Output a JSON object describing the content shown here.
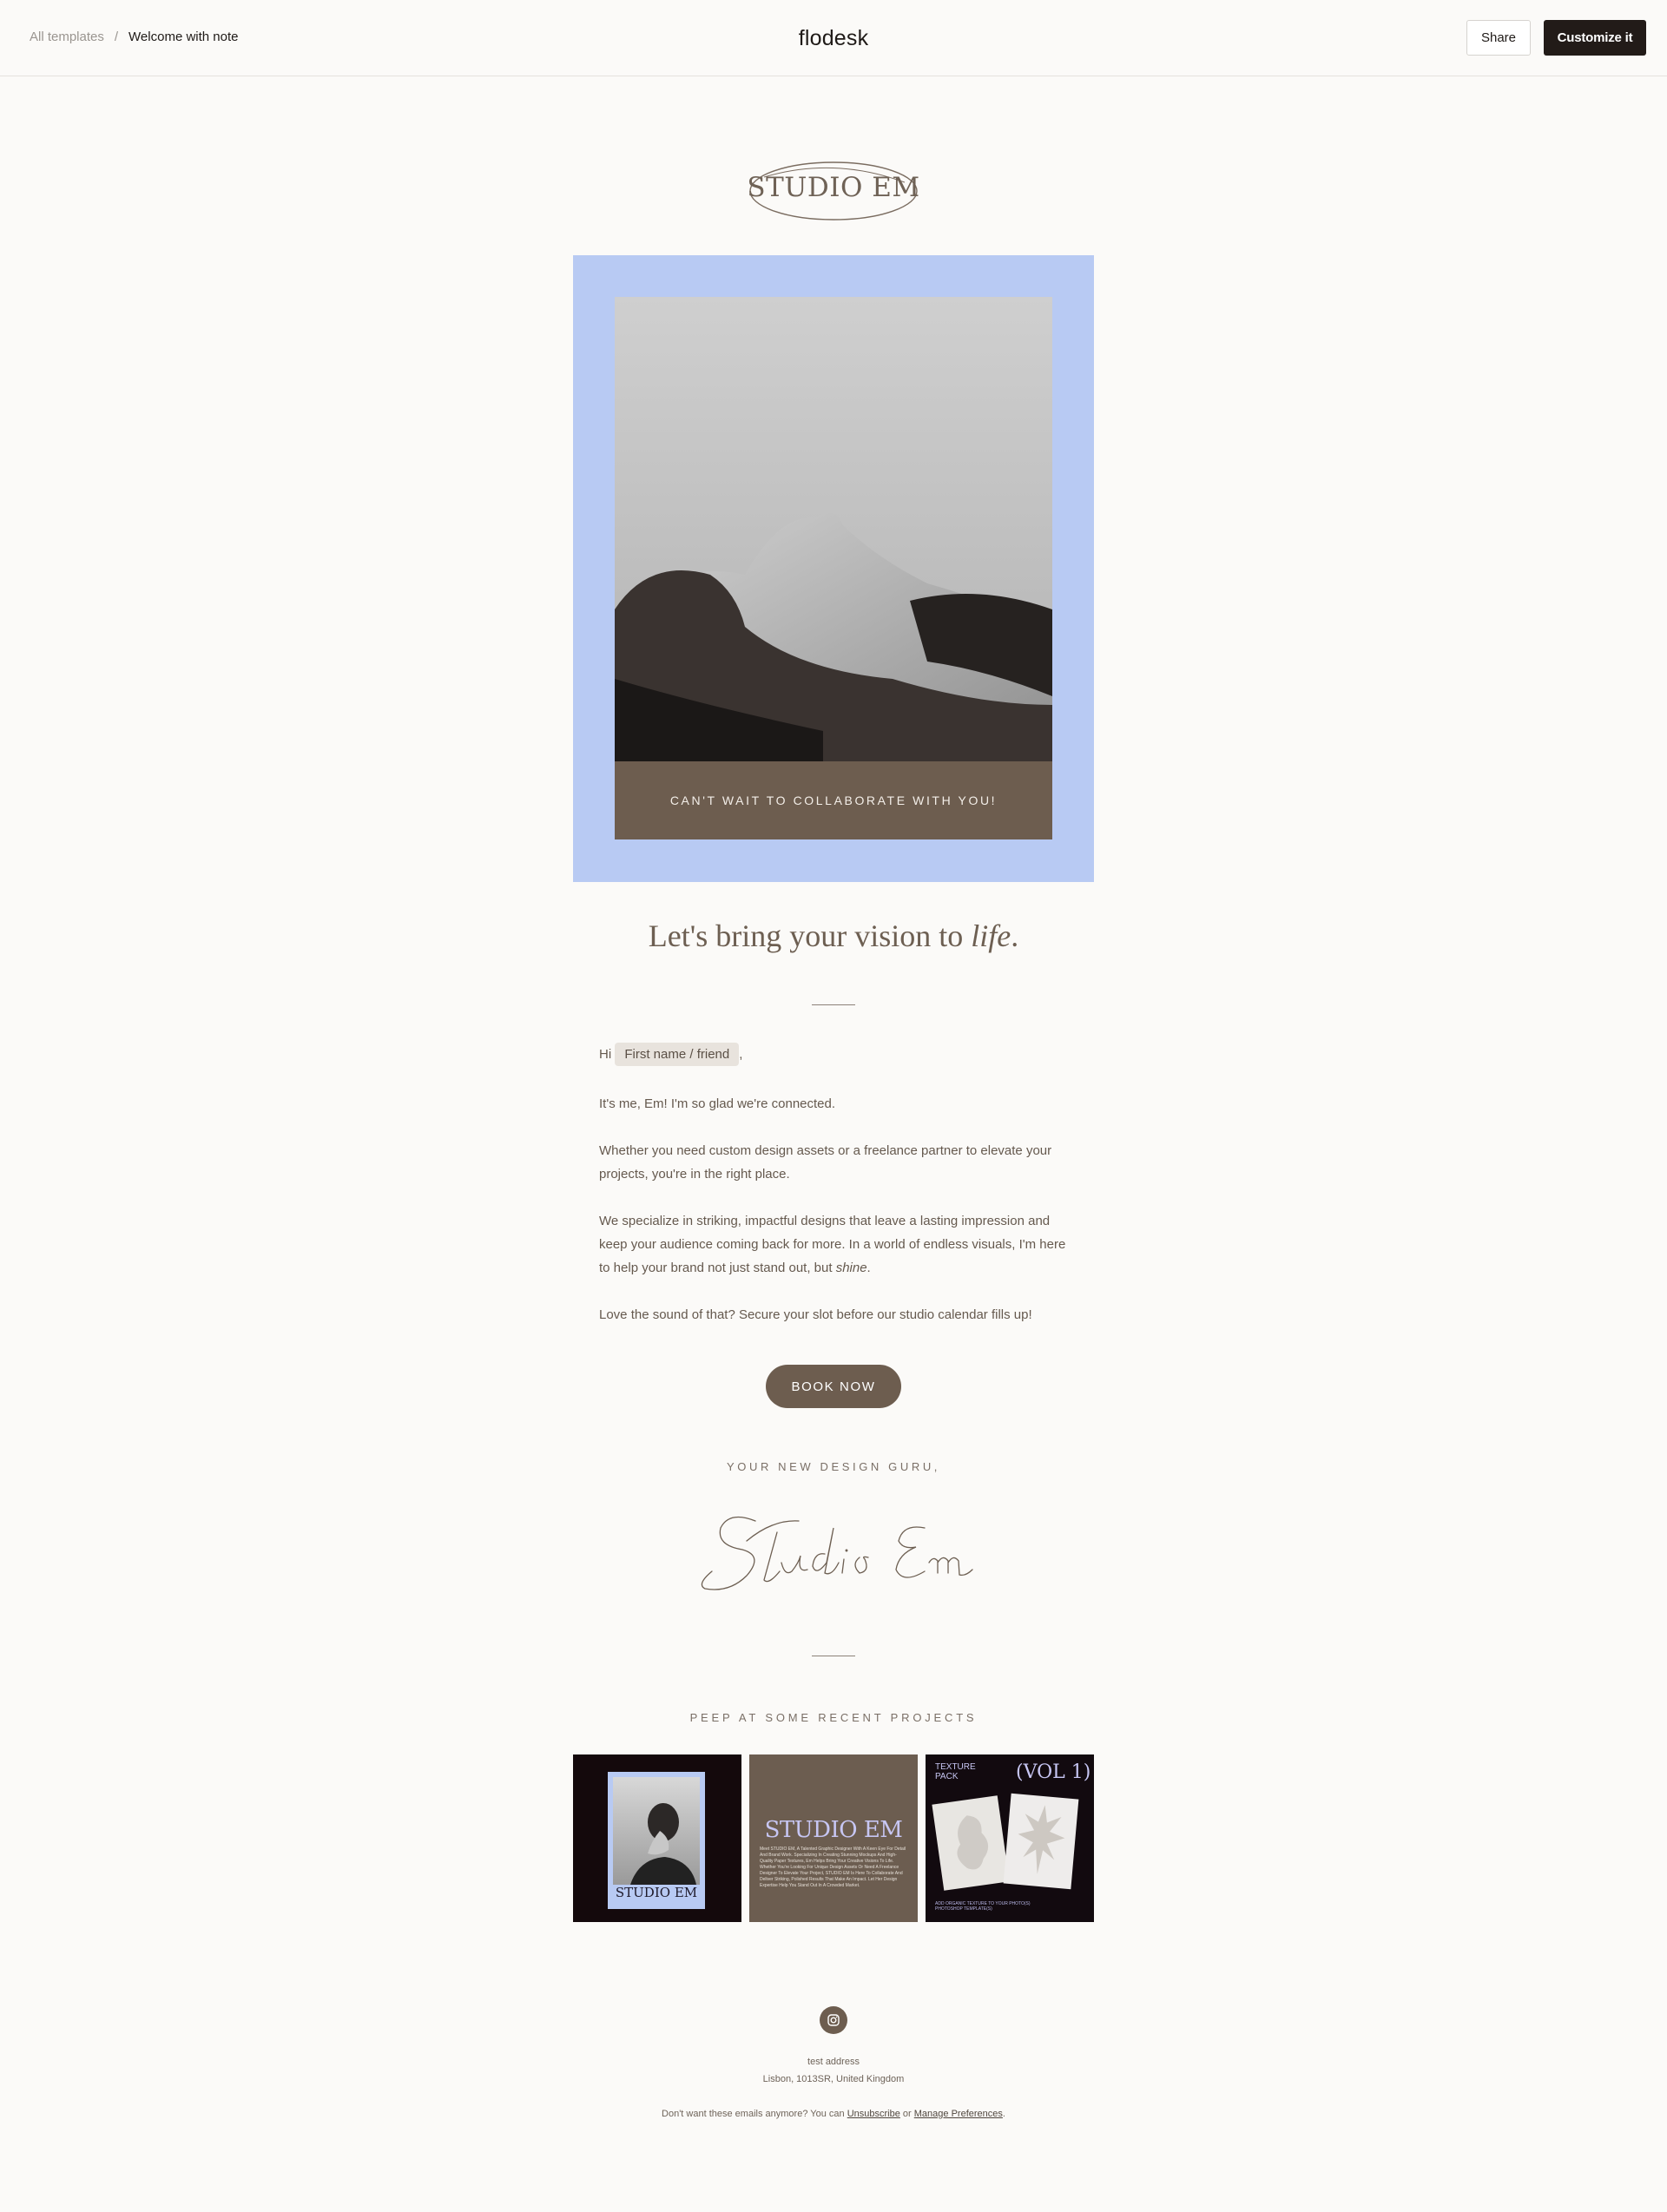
{
  "topbar": {
    "breadcrumb_root": "All templates",
    "breadcrumb_sep": "/",
    "breadcrumb_current": "Welcome with note",
    "brand": "flodesk",
    "share_label": "Share",
    "customize_label": "Customize it"
  },
  "email": {
    "logo_text": "STUDIO EM",
    "hero_caption": "CAN'T WAIT TO COLLABORATE WITH YOU!",
    "headline_main": "Let's bring your vision to ",
    "headline_italic": "life",
    "headline_end": ".",
    "greeting_prefix": "Hi",
    "greeting_tag": "First name / friend",
    "greeting_suffix": ",",
    "para1": "It's me, Em! I'm so glad we're connected.",
    "para2_line1": "Whether you need custom design assets or a freelance partner to elevate your",
    "para2_line2": "projects, you're in the right place.",
    "para3_line1": "We specialize in striking, impactful designs that leave a lasting impression and",
    "para3_line2": "keep your audience coming back for more. In a world of endless visuals, I'm here",
    "para3_line3": "to help your brand not just stand out, but ",
    "para3_italic": "shine",
    "para3_end": ".",
    "para4": "Love the sound of that? Secure your slot before our studio calendar fills up!",
    "cta_label": "BOOK NOW",
    "signoff": "YOUR NEW DESIGN GURU,",
    "signature": "Studio Em",
    "projects_heading": "PEEP AT SOME RECENT PROJECTS",
    "projects": [
      {
        "title": "STUDIO EM"
      },
      {
        "title": "STUDIO EM",
        "body": "Meet STUDIO EM, A Talented Graphic Designer With A Keen Eye For Detail And Brand Work. Specializing In Creating Stunning Mockups And High-Quality Paper Textures, Em Helps Bring Your Creative Visions To Life. Whether You're Looking For Unique Design Assets Or Need A Freelance Designer To Elevate Your Project, STUDIO EM Is Here To Collaborate And Deliver Striking, Polished Results That Make An Impact. Let Her Design Expertise Help You Stand Out In A Crowded Market."
      },
      {
        "label": "TEXTURE PACK",
        "title": "(VOL 1)",
        "caption": "ADD ORGANIC TEXTURE TO YOUR PHOTO(S) PHOTOSHOP TEMPLATE(S)"
      }
    ],
    "footer_address1": "test address",
    "footer_address2": "Lisbon, 1013SR, United Kingdom",
    "footer_unsub_prefix": "Don't want these emails anymore? You can ",
    "footer_unsub_link": "Unsubscribe",
    "footer_or": " or ",
    "footer_prefs_link": "Manage Preferences",
    "footer_end": "."
  },
  "colors": {
    "page_bg": "#fbfaf8",
    "hero_frame": "#b8caf3",
    "brown_accent": "#6d5d4f",
    "dark_button": "#221b18"
  },
  "icons": [
    "instagram-icon"
  ]
}
